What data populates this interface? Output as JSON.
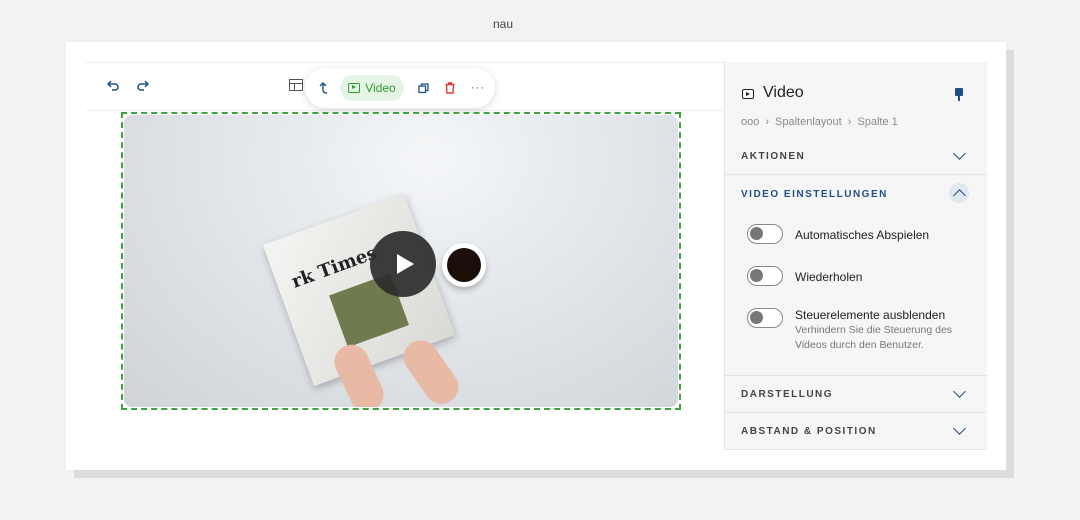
{
  "editor": {
    "hidden_label": "nau"
  },
  "floating_toolbar": {
    "video_label": "Video"
  },
  "video": {
    "newspaper_title": "rk Times"
  },
  "panel": {
    "title": "Video",
    "breadcrumb": {
      "ellipsis": "ooo",
      "items": [
        "Spaltenlayout",
        "Spalte 1"
      ]
    },
    "sections": {
      "aktionen": "AKTIONEN",
      "video_settings": "VIDEO EINSTELLUNGEN",
      "darstellung": "DARSTELLUNG",
      "abstand": "ABSTAND & POSITION"
    },
    "toggles": [
      {
        "label": "Automatisches Abspielen",
        "description": ""
      },
      {
        "label": "Wiederholen",
        "description": ""
      },
      {
        "label": "Steuerelemente ausblenden",
        "description": "Verhindern Sie die Steuerung des Videos durch den Benutzer."
      }
    ]
  },
  "colors": {
    "accent": "#1f4e8c",
    "selection": "#3fa33f",
    "delete": "#e53935"
  }
}
